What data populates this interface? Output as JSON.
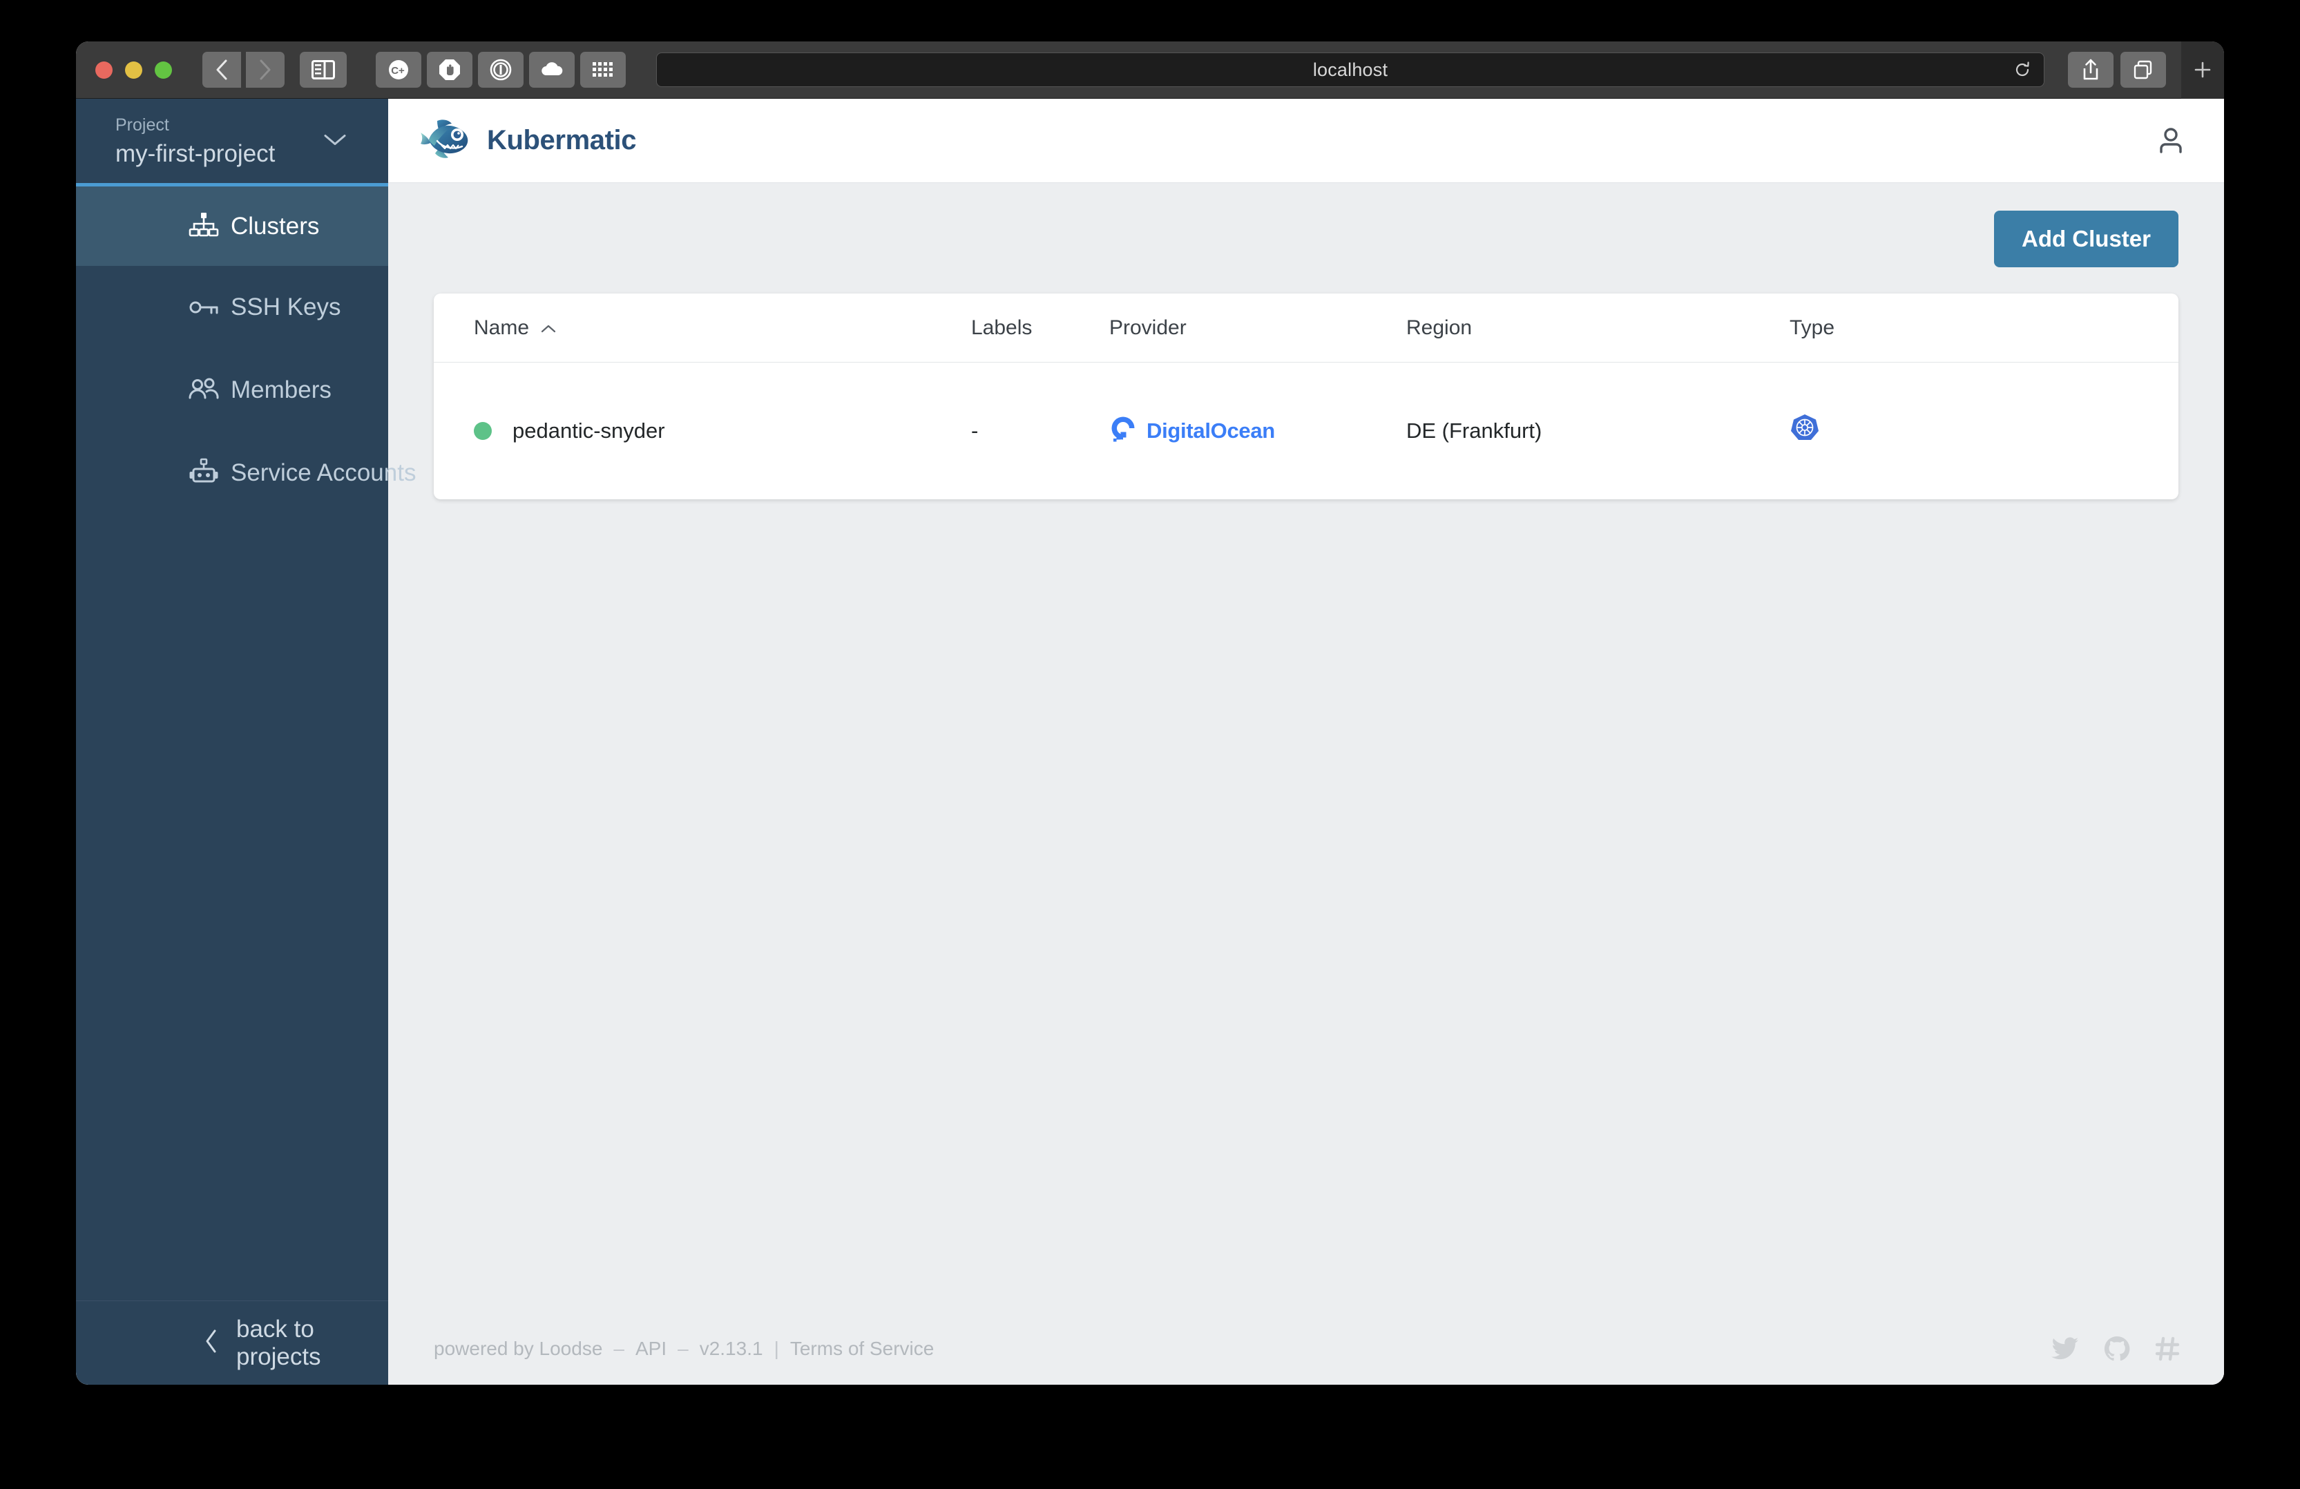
{
  "browser": {
    "address_value": "localhost",
    "traffic_lights": [
      "close-button",
      "minimize-button",
      "maximize-button"
    ],
    "nav_back": "back-button",
    "nav_forward": "forward-button",
    "sidebar_toggle": "sidebar-toggle-button",
    "extensions": [
      "cookie-plus-icon",
      "adblock-hand-icon",
      "onepassword-icon",
      "cloud-icon",
      "apps-grid-icon"
    ],
    "reload": "reload-icon",
    "share": "share-button",
    "tab_overview": "tab-overview-button",
    "new_tab": "+"
  },
  "sidebar": {
    "project_label": "Project",
    "project_name": "my-first-project",
    "items": [
      {
        "label": "Clusters",
        "icon": "clusters-icon",
        "active": true
      },
      {
        "label": "SSH Keys",
        "icon": "key-icon",
        "active": false
      },
      {
        "label": "Members",
        "icon": "members-icon",
        "active": false
      },
      {
        "label": "Service Accounts",
        "icon": "robot-icon",
        "active": false
      }
    ],
    "back_label": "back to projects"
  },
  "header": {
    "brand_name": "Kubermatic",
    "logo": "kubermatic-fish-logo",
    "user_icon": "user-icon"
  },
  "main": {
    "add_cluster_label": "Add Cluster",
    "table": {
      "columns": [
        "Name",
        "Labels",
        "Provider",
        "Region",
        "Type"
      ],
      "sorted_column": "Name",
      "sort_direction": "asc",
      "rows": [
        {
          "status": "running",
          "name": "pedantic-snyder",
          "labels": "-",
          "provider": "DigitalOcean",
          "region": "DE (Frankfurt)",
          "type": "kubernetes"
        }
      ]
    }
  },
  "footer": {
    "powered_by": "powered by Loodse",
    "dash1": "–",
    "api_label": "API",
    "dash2": "–",
    "version": "v2.13.1",
    "pipe": "|",
    "terms": "Terms of Service",
    "icons": [
      "twitter-icon",
      "github-icon",
      "slack-icon"
    ]
  },
  "colors": {
    "sidebar_bg": "#2b4359",
    "sidebar_active_bg": "#3b5a70",
    "accent_blue": "#4b9cd3",
    "button_blue": "#3b7ea7",
    "brand_navy": "#2c5179",
    "status_green": "#5dc288",
    "digitalocean_blue": "#3b7ef7",
    "kubernetes_blue": "#3f6fd8",
    "page_bg": "#eceef0"
  }
}
